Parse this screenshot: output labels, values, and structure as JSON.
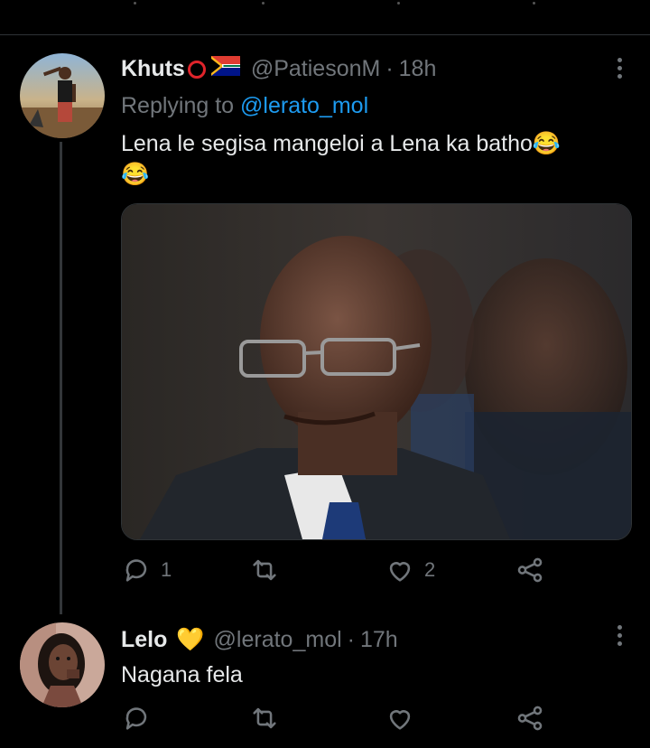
{
  "tweets": [
    {
      "name": "Khuts",
      "handle": "@PatiesonM",
      "separator": "·",
      "time": "18h",
      "replying_prefix": "Replying to ",
      "replying_to": "@lerato_mol",
      "text": "Lena le segisa mangeloi a Lena ka batho😂",
      "text_line2": "😂",
      "avatar_icon": "person-avatar",
      "media_icon": "photo-man-with-glasses",
      "actions": {
        "reply_count": "1",
        "retweet_count": "",
        "like_count": "2"
      }
    },
    {
      "name": "Lelo",
      "name_emoji": "💛",
      "handle": "@lerato_mol",
      "separator": "·",
      "time": "17h",
      "text": "Nagana fela",
      "avatar_icon": "person-avatar",
      "actions": {
        "reply_count": "",
        "retweet_count": "",
        "like_count": ""
      }
    }
  ],
  "colors": {
    "background": "#000000",
    "text": "#e7e9ea",
    "muted": "#71767b",
    "link": "#1d9bf0",
    "border": "#2f3336"
  }
}
